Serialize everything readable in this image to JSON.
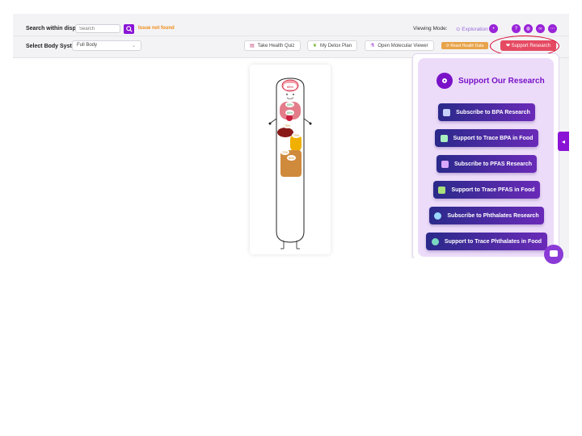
{
  "toolbar": {
    "search_label": "Search within display",
    "search_placeholder": "Search",
    "search_status": "Issue not found",
    "viewing_mode_label": "Viewing Mode:",
    "viewing_mode_value": "Exploration",
    "body_system_label": "Select Body System:",
    "body_system_value": "Full Body",
    "buttons": {
      "quiz": "Take Health Quiz",
      "detox": "My Detox Plan",
      "molecular": "Open Molecular Viewer",
      "reset": "Reset Health Data",
      "support": "Support Research"
    }
  },
  "figure": {
    "labels": [
      "85%",
      "65%",
      "60%",
      "75%",
      "70%",
      "72%",
      "80%"
    ]
  },
  "panel": {
    "title": "Support Our Research",
    "buttons": [
      {
        "label": "Subscribe to BPA Research",
        "icon": "flask-icon"
      },
      {
        "label": "Support to Trace BPA in Food",
        "icon": "pipette-icon"
      },
      {
        "label": "Subscribe to PFAS Research",
        "icon": "test-tube-icon"
      },
      {
        "label": "Support to Trace PFAS in Food",
        "icon": "plant-icon"
      },
      {
        "label": "Subscribe to Phthalates Research",
        "icon": "bubble-icon"
      },
      {
        "label": "Support to Trace Phthalates in Food",
        "icon": "food-icon"
      }
    ]
  },
  "colors": {
    "accent": "#8a14d6",
    "support": "#e64a62",
    "reset": "#e8a44a",
    "warning": "#f08a14"
  }
}
